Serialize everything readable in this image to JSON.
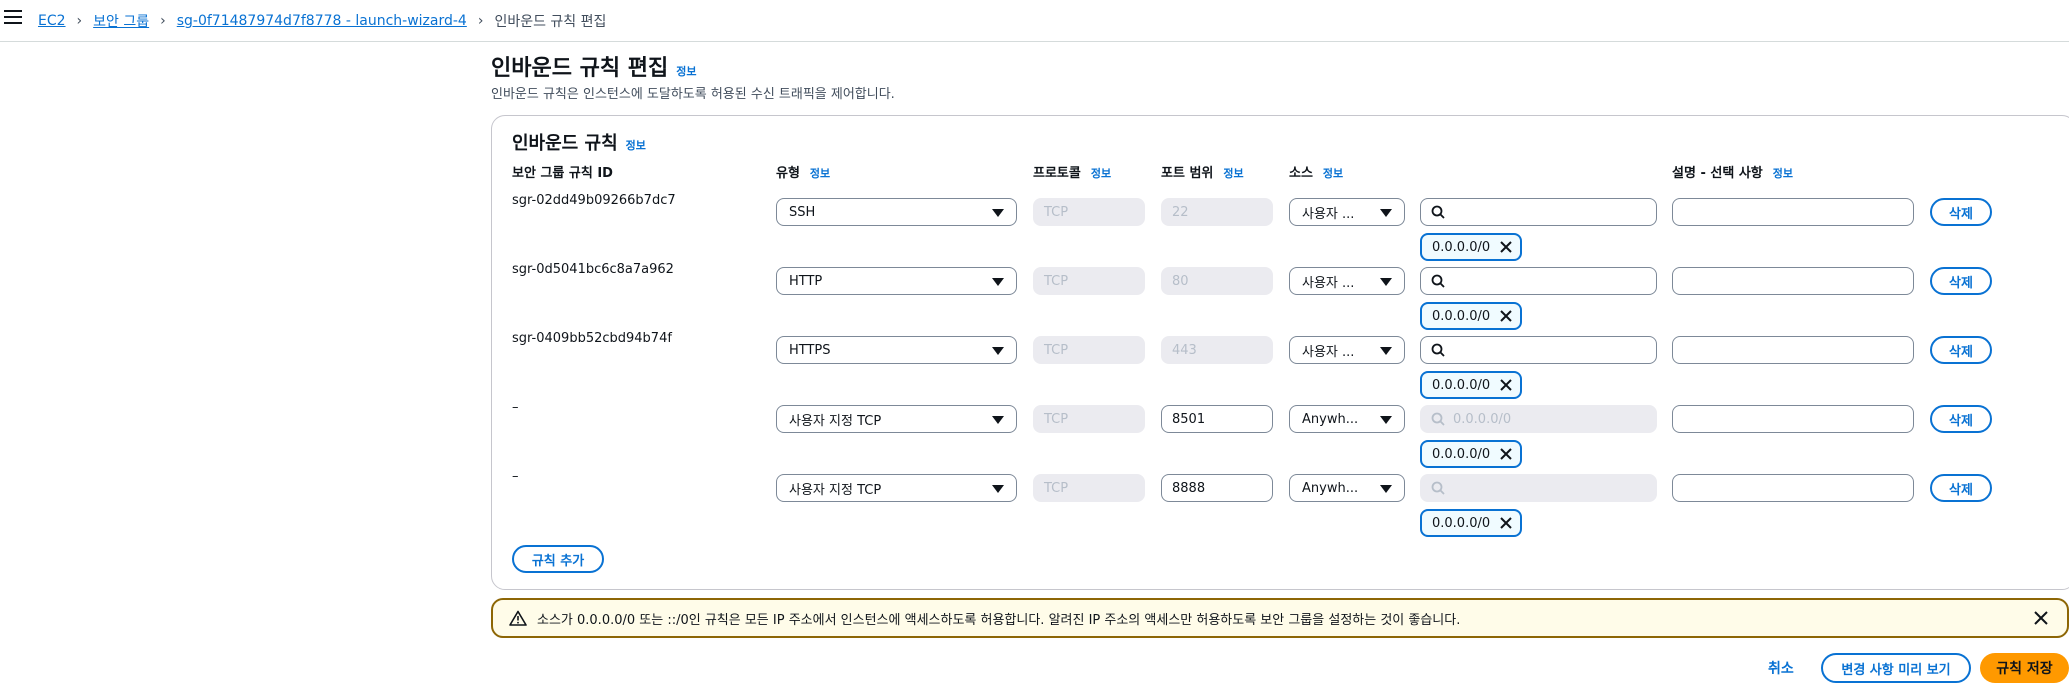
{
  "breadcrumb": {
    "items": [
      "EC2",
      "보안 그룹",
      "sg-0f71487974d7f8778 - launch-wizard-4"
    ],
    "current": "인바운드 규칙 편집"
  },
  "header": {
    "title": "인바운드 규칙 편집",
    "info": "정보",
    "description": "인바운드 규칙은 인스턴스에 도달하도록 허용된 수신 트래픽을 제어합니다."
  },
  "panel": {
    "title": "인바운드 규칙",
    "info": "정보",
    "columns": {
      "rule_id": "보안 그룹 규칙 ID",
      "type": "유형",
      "protocol": "프로토콜",
      "port_range": "포트 범위",
      "source": "소스",
      "description": "설명 - 선택 사항",
      "info": "정보"
    },
    "rows": [
      {
        "rule_id": "sgr-02dd49b09266b7dc7",
        "type": "SSH",
        "protocol": "TCP",
        "port": "22",
        "source": "사용자 ...",
        "search_placeholder": "",
        "cidr": "0.0.0.0/0",
        "description": "",
        "delete": "삭제"
      },
      {
        "rule_id": "sgr-0d5041bc6c8a7a962",
        "type": "HTTP",
        "protocol": "TCP",
        "port": "80",
        "source": "사용자 ...",
        "search_placeholder": "",
        "cidr": "0.0.0.0/0",
        "description": "",
        "delete": "삭제"
      },
      {
        "rule_id": "sgr-0409bb52cbd94b74f",
        "type": "HTTPS",
        "protocol": "TCP",
        "port": "443",
        "source": "사용자 ...",
        "search_placeholder": "",
        "cidr": "0.0.0.0/0",
        "description": "",
        "delete": "삭제"
      },
      {
        "rule_id": "–",
        "type": "사용자 지정 TCP",
        "protocol": "TCP",
        "port": "8501",
        "source": "Anywh...",
        "search_placeholder": "0.0.0.0/0",
        "cidr": "0.0.0.0/0",
        "description": "",
        "delete": "삭제"
      },
      {
        "rule_id": "–",
        "type": "사용자 지정 TCP",
        "protocol": "TCP",
        "port": "8888",
        "source": "Anywh...",
        "search_placeholder": "",
        "cidr": "0.0.0.0/0",
        "description": "",
        "delete": "삭제"
      }
    ],
    "add_rule": "규칙 추가"
  },
  "alert": {
    "text": "소스가 0.0.0.0/0 또는 ::/0인 규칙은 모든 IP 주소에서 인스턴스에 액세스하도록 허용합니다. 알려진 IP 주소의 액세스만 허용하도록 보안 그룹을 설정하는 것이 좋습니다."
  },
  "footer": {
    "cancel": "취소",
    "preview": "변경 사항 미리 보기",
    "save": "규칙 저장"
  }
}
